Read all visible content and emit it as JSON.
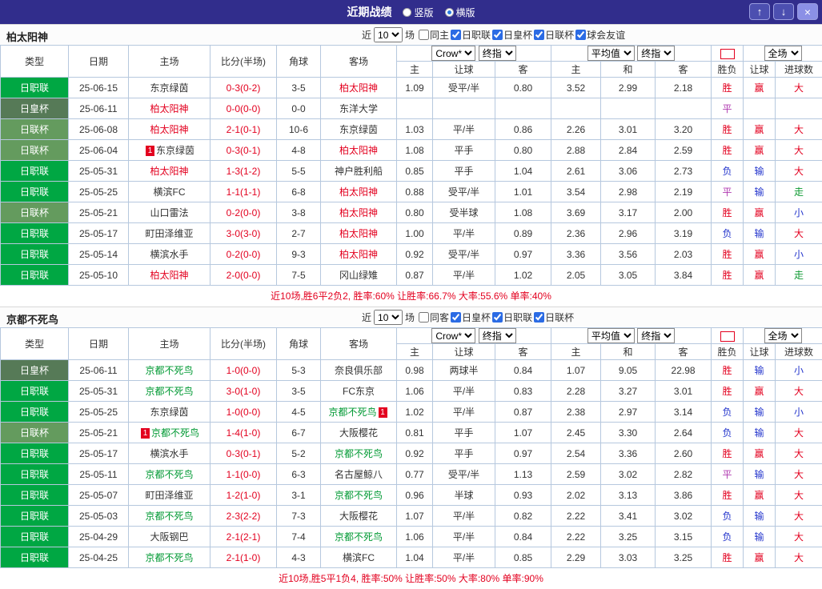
{
  "colors": {
    "topbar_bg": "#312d8c",
    "accent_blue": "#2b6be4",
    "win_red": "#e3001f",
    "lose_blue": "#2334cc",
    "push_green": "#0f9a32",
    "draw_purple": "#b03ab0",
    "league_j1_green": "#00a743",
    "league_emperor_green": "#567a57",
    "league_levain_green": "#649b5e",
    "team1_color": "#e3001f",
    "team2_color": "#009933",
    "grid_border": "#b6c8de"
  },
  "topbar": {
    "title": "近期战绩",
    "radios": [
      {
        "label": "竖版",
        "selected": false
      },
      {
        "label": "横版",
        "selected": true
      }
    ],
    "buttons": {
      "up": "↑",
      "down": "↓",
      "close": "×"
    }
  },
  "table_header": {
    "type": "类型",
    "date": "日期",
    "home": "主场",
    "score": "比分(半场)",
    "corner": "角球",
    "away": "客场",
    "asia_selects": [
      "Crow*",
      "终指"
    ],
    "euro_selects": [
      "平均值",
      "终指"
    ],
    "period_select": "全场",
    "sub": [
      "主",
      "让球",
      "客",
      "主",
      "和",
      "客",
      "胜负",
      "让球",
      "进球数"
    ]
  },
  "sections": [
    {
      "team": "柏太阳神",
      "team_color": "#e3001f",
      "filter": {
        "near": "近",
        "count": "10",
        "unit": "场",
        "checkboxes": [
          {
            "label": "同主",
            "checked": false
          },
          {
            "label": "日职联",
            "checked": true
          },
          {
            "label": "日皇杯",
            "checked": true
          },
          {
            "label": "日联杯",
            "checked": true
          },
          {
            "label": "球会友谊",
            "checked": true
          }
        ]
      },
      "rows": [
        {
          "league": "日职联",
          "date": "25-06-15",
          "home": {
            "name": "东京绿茵"
          },
          "score": "0-3(0-2)",
          "corner": "3-5",
          "away": {
            "name": "柏太阳神",
            "focus": true
          },
          "asia": [
            "1.09",
            "受平/半",
            "0.80"
          ],
          "euro": [
            "3.52",
            "2.99",
            "2.18"
          ],
          "result": "胜",
          "handicap_result": "赢",
          "goals_result": "大"
        },
        {
          "league": "日皇杯",
          "date": "25-06-11",
          "home": {
            "name": "柏太阳神",
            "focus": true
          },
          "score": "0-0(0-0)",
          "corner": "0-0",
          "away": {
            "name": "东洋大学"
          },
          "asia": [
            "",
            "",
            ""
          ],
          "euro": [
            "",
            "",
            ""
          ],
          "result": "平",
          "handicap_result": "",
          "goals_result": ""
        },
        {
          "league": "日联杯",
          "date": "25-06-08",
          "home": {
            "name": "柏太阳神",
            "focus": true
          },
          "score": "2-1(0-1)",
          "corner": "10-6",
          "away": {
            "name": "东京绿茵"
          },
          "asia": [
            "1.03",
            "平/半",
            "0.86"
          ],
          "euro": [
            "2.26",
            "3.01",
            "3.20"
          ],
          "result": "胜",
          "handicap_result": "赢",
          "goals_result": "大"
        },
        {
          "league": "日联杯",
          "date": "25-06-04",
          "home": {
            "name": "东京绿茵",
            "card_before": "1"
          },
          "score": "0-3(0-1)",
          "corner": "4-8",
          "away": {
            "name": "柏太阳神",
            "focus": true
          },
          "asia": [
            "1.08",
            "平手",
            "0.80"
          ],
          "euro": [
            "2.88",
            "2.84",
            "2.59"
          ],
          "result": "胜",
          "handicap_result": "赢",
          "goals_result": "大"
        },
        {
          "league": "日职联",
          "date": "25-05-31",
          "home": {
            "name": "柏太阳神",
            "focus": true
          },
          "score": "1-3(1-2)",
          "corner": "5-5",
          "away": {
            "name": "神户胜利船"
          },
          "asia": [
            "0.85",
            "平手",
            "1.04"
          ],
          "euro": [
            "2.61",
            "3.06",
            "2.73"
          ],
          "result": "负",
          "handicap_result": "输",
          "goals_result": "大"
        },
        {
          "league": "日职联",
          "date": "25-05-25",
          "home": {
            "name": "横滨FC"
          },
          "score": "1-1(1-1)",
          "corner": "6-8",
          "away": {
            "name": "柏太阳神",
            "focus": true
          },
          "asia": [
            "0.88",
            "受平/半",
            "1.01"
          ],
          "euro": [
            "3.54",
            "2.98",
            "2.19"
          ],
          "result": "平",
          "handicap_result": "输",
          "goals_result": "走"
        },
        {
          "league": "日联杯",
          "date": "25-05-21",
          "home": {
            "name": "山口雷法"
          },
          "score": "0-2(0-0)",
          "corner": "3-8",
          "away": {
            "name": "柏太阳神",
            "focus": true
          },
          "asia": [
            "0.80",
            "受半球",
            "1.08"
          ],
          "euro": [
            "3.69",
            "3.17",
            "2.00"
          ],
          "result": "胜",
          "handicap_result": "赢",
          "goals_result": "小"
        },
        {
          "league": "日职联",
          "date": "25-05-17",
          "home": {
            "name": "町田泽维亚"
          },
          "score": "3-0(3-0)",
          "corner": "2-7",
          "away": {
            "name": "柏太阳神",
            "focus": true
          },
          "asia": [
            "1.00",
            "平/半",
            "0.89"
          ],
          "euro": [
            "2.36",
            "2.96",
            "3.19"
          ],
          "result": "负",
          "handicap_result": "输",
          "goals_result": "大"
        },
        {
          "league": "日职联",
          "date": "25-05-14",
          "home": {
            "name": "横滨水手"
          },
          "score": "0-2(0-0)",
          "corner": "9-3",
          "away": {
            "name": "柏太阳神",
            "focus": true
          },
          "asia": [
            "0.92",
            "受平/半",
            "0.97"
          ],
          "euro": [
            "3.36",
            "3.56",
            "2.03"
          ],
          "result": "胜",
          "handicap_result": "赢",
          "goals_result": "小"
        },
        {
          "league": "日职联",
          "date": "25-05-10",
          "home": {
            "name": "柏太阳神",
            "focus": true
          },
          "score": "2-0(0-0)",
          "corner": "7-5",
          "away": {
            "name": "冈山绿雉"
          },
          "asia": [
            "0.87",
            "平/半",
            "1.02"
          ],
          "euro": [
            "2.05",
            "3.05",
            "3.84"
          ],
          "result": "胜",
          "handicap_result": "赢",
          "goals_result": "走"
        }
      ],
      "summary": "近10场,胜6平2负2, 胜率:60% 让胜率:66.7% 大率:55.6% 单率:40%"
    },
    {
      "team": "京都不死鸟",
      "team_color": "#009933",
      "filter": {
        "near": "近",
        "count": "10",
        "unit": "场",
        "checkboxes": [
          {
            "label": "同客",
            "checked": false
          },
          {
            "label": "日皇杯",
            "checked": true
          },
          {
            "label": "日职联",
            "checked": true
          },
          {
            "label": "日联杯",
            "checked": true
          }
        ]
      },
      "rows": [
        {
          "league": "日皇杯",
          "date": "25-06-11",
          "home": {
            "name": "京都不死鸟",
            "focus": true
          },
          "score": "1-0(0-0)",
          "corner": "5-3",
          "away": {
            "name": "奈良俱乐部"
          },
          "asia": [
            "0.98",
            "两球半",
            "0.84"
          ],
          "euro": [
            "1.07",
            "9.05",
            "22.98"
          ],
          "result": "胜",
          "handicap_result": "输",
          "goals_result": "小"
        },
        {
          "league": "日职联",
          "date": "25-05-31",
          "home": {
            "name": "京都不死鸟",
            "focus": true
          },
          "score": "3-0(1-0)",
          "corner": "3-5",
          "away": {
            "name": "FC东京"
          },
          "asia": [
            "1.06",
            "平/半",
            "0.83"
          ],
          "euro": [
            "2.28",
            "3.27",
            "3.01"
          ],
          "result": "胜",
          "handicap_result": "赢",
          "goals_result": "大"
        },
        {
          "league": "日职联",
          "date": "25-05-25",
          "home": {
            "name": "东京绿茵"
          },
          "score": "1-0(0-0)",
          "corner": "4-5",
          "away": {
            "name": "京都不死鸟",
            "focus": true,
            "card_after": "1"
          },
          "asia": [
            "1.02",
            "平/半",
            "0.87"
          ],
          "euro": [
            "2.38",
            "2.97",
            "3.14"
          ],
          "result": "负",
          "handicap_result": "输",
          "goals_result": "小"
        },
        {
          "league": "日联杯",
          "date": "25-05-21",
          "home": {
            "name": "京都不死鸟",
            "focus": true,
            "card_before": "1"
          },
          "score": "1-4(1-0)",
          "corner": "6-7",
          "away": {
            "name": "大阪樱花"
          },
          "asia": [
            "0.81",
            "平手",
            "1.07"
          ],
          "euro": [
            "2.45",
            "3.30",
            "2.64"
          ],
          "result": "负",
          "handicap_result": "输",
          "goals_result": "大"
        },
        {
          "league": "日职联",
          "date": "25-05-17",
          "home": {
            "name": "横滨水手"
          },
          "score": "0-3(0-1)",
          "corner": "5-2",
          "away": {
            "name": "京都不死鸟",
            "focus": true
          },
          "asia": [
            "0.92",
            "平手",
            "0.97"
          ],
          "euro": [
            "2.54",
            "3.36",
            "2.60"
          ],
          "result": "胜",
          "handicap_result": "赢",
          "goals_result": "大"
        },
        {
          "league": "日职联",
          "date": "25-05-11",
          "home": {
            "name": "京都不死鸟",
            "focus": true
          },
          "score": "1-1(0-0)",
          "corner": "6-3",
          "away": {
            "name": "名古屋鲸八"
          },
          "asia": [
            "0.77",
            "受平/半",
            "1.13"
          ],
          "euro": [
            "2.59",
            "3.02",
            "2.82"
          ],
          "result": "平",
          "handicap_result": "输",
          "goals_result": "大"
        },
        {
          "league": "日职联",
          "date": "25-05-07",
          "home": {
            "name": "町田泽维亚"
          },
          "score": "1-2(1-0)",
          "corner": "3-1",
          "away": {
            "name": "京都不死鸟",
            "focus": true
          },
          "asia": [
            "0.96",
            "半球",
            "0.93"
          ],
          "euro": [
            "2.02",
            "3.13",
            "3.86"
          ],
          "result": "胜",
          "handicap_result": "赢",
          "goals_result": "大"
        },
        {
          "league": "日职联",
          "date": "25-05-03",
          "home": {
            "name": "京都不死鸟",
            "focus": true
          },
          "score": "2-3(2-2)",
          "corner": "7-3",
          "away": {
            "name": "大阪樱花"
          },
          "asia": [
            "1.07",
            "平/半",
            "0.82"
          ],
          "euro": [
            "2.22",
            "3.41",
            "3.02"
          ],
          "result": "负",
          "handicap_result": "输",
          "goals_result": "大"
        },
        {
          "league": "日职联",
          "date": "25-04-29",
          "home": {
            "name": "大阪钢巴"
          },
          "score": "2-1(2-1)",
          "corner": "7-4",
          "away": {
            "name": "京都不死鸟",
            "focus": true
          },
          "asia": [
            "1.06",
            "平/半",
            "0.84"
          ],
          "euro": [
            "2.22",
            "3.25",
            "3.15"
          ],
          "result": "负",
          "handicap_result": "输",
          "goals_result": "大"
        },
        {
          "league": "日职联",
          "date": "25-04-25",
          "home": {
            "name": "京都不死鸟",
            "focus": true
          },
          "score": "2-1(1-0)",
          "corner": "4-3",
          "away": {
            "name": "横滨FC"
          },
          "asia": [
            "1.04",
            "平/半",
            "0.85"
          ],
          "euro": [
            "2.29",
            "3.03",
            "3.25"
          ],
          "result": "胜",
          "handicap_result": "赢",
          "goals_result": "大"
        }
      ],
      "summary": "近10场,胜5平1负4, 胜率:50% 让胜率:50% 大率:80% 单率:90%"
    }
  ]
}
